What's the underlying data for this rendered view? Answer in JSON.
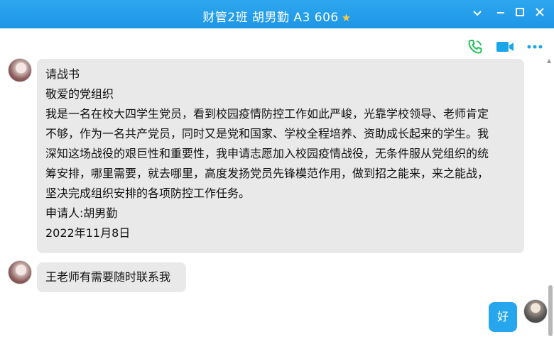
{
  "window": {
    "title": "财管2班 胡男勤  A3 606",
    "star_icon": "star-icon",
    "controls": [
      "chevron-down-icon",
      "minimize-icon",
      "maximize-icon",
      "close-icon"
    ]
  },
  "toolbar": {
    "icons": [
      "phone-call-icon",
      "video-call-icon",
      "more-icon"
    ],
    "accent_color": "#1aa6e8"
  },
  "messages": [
    {
      "side": "left",
      "lines": [
        "请战书",
        "敬爱的党组织",
        "我是一名在校大四学生党员，看到校园疫情防控工作如此严峻，光靠学校领导、老师肯定",
        "不够，作为一名共产党员，同时又是党和国家、学校全程培养、资助成长起来的学生。我",
        "深知这场战役的艰巨性和重要性，我申请志愿加入校园疫情战役，无条件服从党组织的统",
        "筹安排，哪里需要，就去哪里，高度发扬党员先锋模范作用，做到招之能来，来之能战，",
        "坚决完成组织安排的各项防控工作任务。",
        "申请人:胡男勤",
        "2022年11月8日"
      ]
    },
    {
      "side": "left",
      "lines": [
        "王老师有需要随时联系我"
      ]
    },
    {
      "side": "right",
      "lines": [
        "好"
      ]
    }
  ]
}
